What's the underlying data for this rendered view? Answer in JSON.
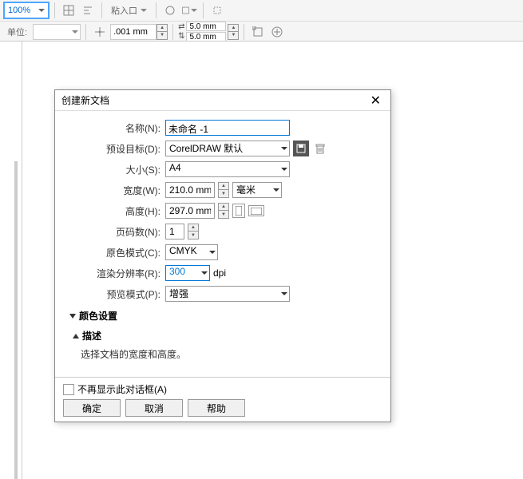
{
  "toolbar": {
    "zoom": "100%",
    "unit_label": "单位:",
    "nudge": ".001 mm",
    "dupX": "5.0 mm",
    "dupY": "5.0 mm",
    "paste_opts": "粘入口"
  },
  "dialog": {
    "title": "创建新文档",
    "labels": {
      "name": "名称(N):",
      "preset": "预设目标(D):",
      "size": "大小(S):",
      "width": "宽度(W):",
      "height": "高度(H):",
      "pages": "页码数(N):",
      "color_mode": "原色模式(C):",
      "resolution": "渲染分辨率(R):",
      "preview": "预览模式(P):"
    },
    "values": {
      "name": "未命名 -1",
      "preset": "CorelDRAW 默认",
      "size": "A4",
      "width": "210.0 mm",
      "height": "297.0 mm",
      "unit": "毫米",
      "pages": "1",
      "color_mode": "CMYK",
      "resolution": "300",
      "dpi": "dpi",
      "preview": "增强"
    },
    "sections": {
      "color": "颜色设置",
      "desc": "描述"
    },
    "desc_text": "选择文档的宽度和高度。",
    "dont_show": "不再显示此对话框(A)",
    "buttons": {
      "ok": "确定",
      "cancel": "取消",
      "help": "帮助"
    }
  }
}
